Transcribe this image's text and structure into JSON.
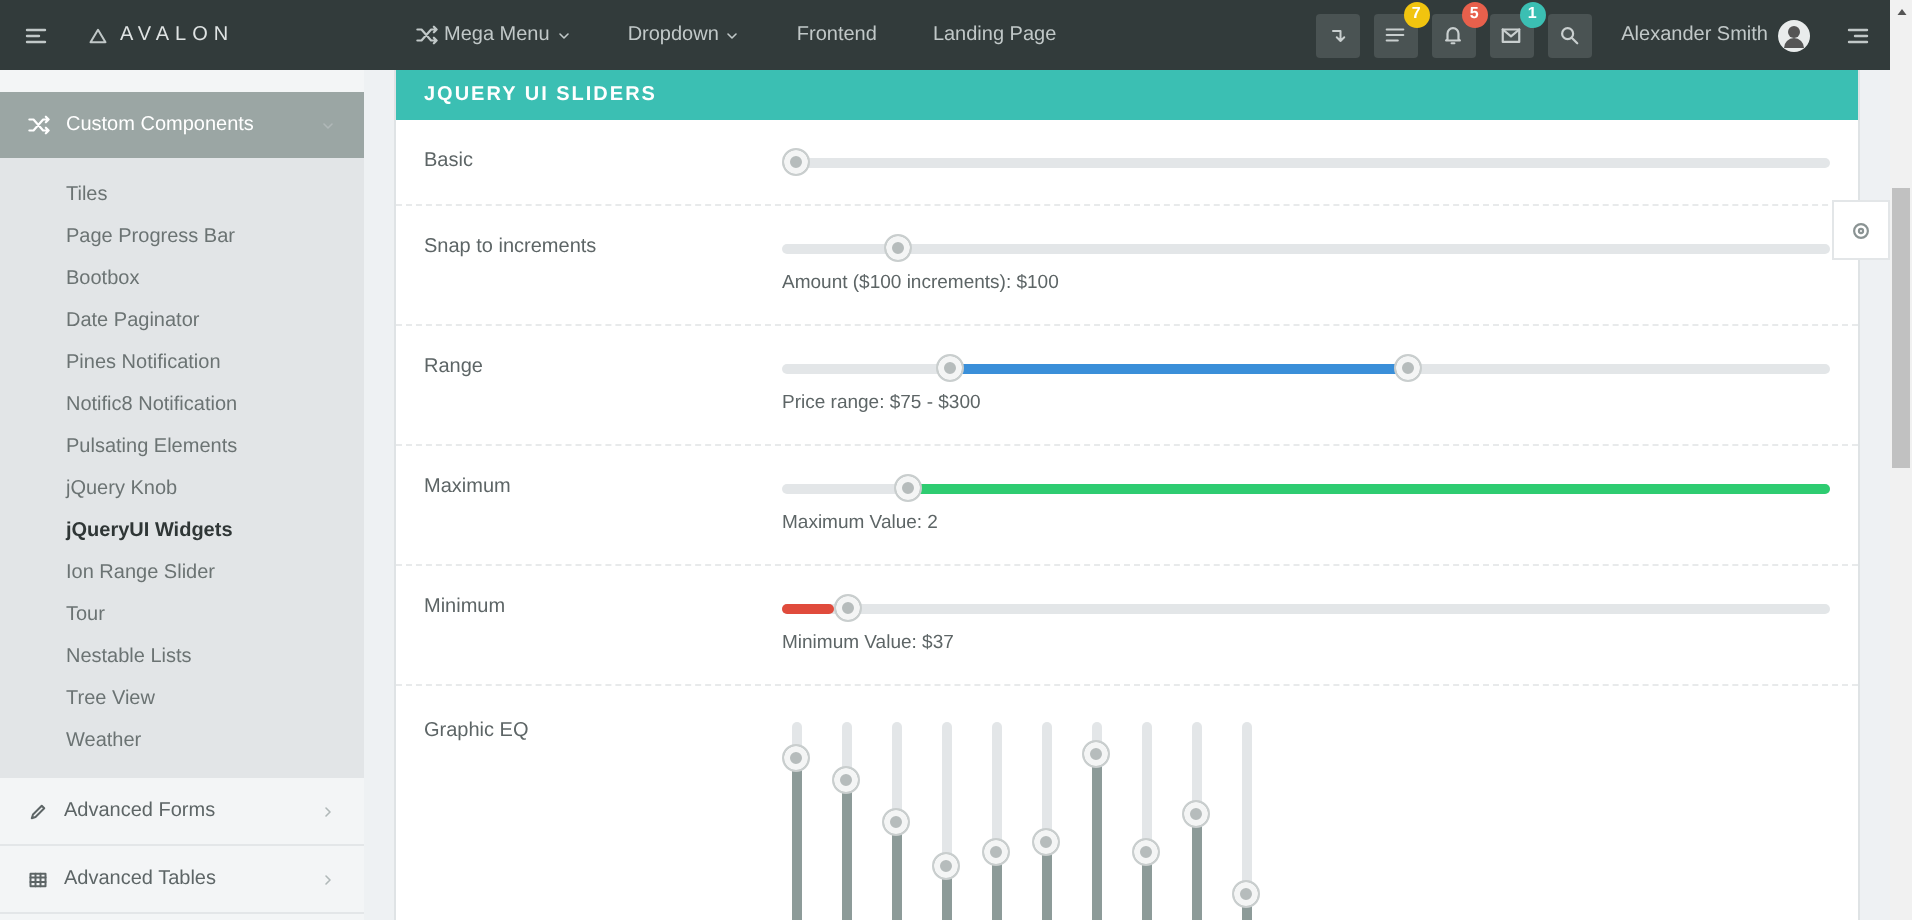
{
  "topbar": {
    "brand": "AVALON",
    "nav": [
      {
        "label": "Mega Menu",
        "icon": true,
        "dropdown": true
      },
      {
        "label": "Dropdown",
        "icon": false,
        "dropdown": true
      },
      {
        "label": "Frontend",
        "icon": false,
        "dropdown": false
      },
      {
        "label": "Landing Page",
        "icon": false,
        "dropdown": false
      }
    ],
    "buttons": [
      {
        "kind": "toggle"
      },
      {
        "kind": "tasks",
        "badge": "7",
        "color": "#f1c40f"
      },
      {
        "kind": "bell",
        "badge": "5",
        "color": "#e8604c"
      },
      {
        "kind": "mail",
        "badge": "1",
        "color": "#3bbfb3"
      },
      {
        "kind": "search"
      }
    ],
    "user": "Alexander Smith"
  },
  "sidebar": {
    "menu": [
      {
        "label": "Custom Components",
        "kind": "shuffle",
        "expanded": true,
        "children": [
          {
            "label": "Tiles",
            "selected": false
          },
          {
            "label": "Page Progress Bar",
            "selected": false
          },
          {
            "label": "Bootbox",
            "selected": false
          },
          {
            "label": "Date Paginator",
            "selected": false
          },
          {
            "label": "Pines Notification",
            "selected": false
          },
          {
            "label": "Notific8 Notification",
            "selected": false
          },
          {
            "label": "Pulsating Elements",
            "selected": false
          },
          {
            "label": "jQuery Knob",
            "selected": false
          },
          {
            "label": "jQueryUI Widgets",
            "selected": true
          },
          {
            "label": "Ion Range Slider",
            "selected": false
          },
          {
            "label": "Tour",
            "selected": false
          },
          {
            "label": "Nestable Lists",
            "selected": false
          },
          {
            "label": "Tree View",
            "selected": false
          },
          {
            "label": "Weather",
            "selected": false
          }
        ]
      },
      {
        "label": "Advanced Forms",
        "kind": "pencil",
        "expanded": false
      },
      {
        "label": "Advanced Tables",
        "kind": "table",
        "expanded": false
      }
    ]
  },
  "panel": {
    "title": "JQUERY UI SLIDERS",
    "rows": [
      {
        "label": "Basic",
        "kind": "single",
        "handles": [
          {
            "level": 0
          }
        ]
      },
      {
        "label": "Snap to increments",
        "kind": "single",
        "handles": [
          {
            "level": 0.1
          }
        ],
        "caption": "Amount ($100 increments): $100"
      },
      {
        "label": "Range",
        "kind": "range",
        "color": "#3a8fd9",
        "handles": [
          {
            "level": 0.15
          },
          {
            "level": 0.6
          }
        ],
        "caption": "Price range: $75 - $300"
      },
      {
        "label": "Maximum",
        "kind": "max",
        "color": "#2ecc71",
        "handles": [
          {
            "level": 0.11
          }
        ],
        "caption": "Maximum Value: 2"
      },
      {
        "label": "Minimum",
        "kind": "min",
        "color": "#e04b3c",
        "handles": [
          {
            "level": 0.05
          }
        ],
        "caption": "Minimum Value: $37"
      },
      {
        "label": "Graphic EQ",
        "kind": "eq",
        "color": "#8d9b99",
        "bands": [
          {
            "level": 0.87
          },
          {
            "level": 0.75
          },
          {
            "level": 0.51
          },
          {
            "level": 0.26
          },
          {
            "level": 0.34
          },
          {
            "level": 0.4
          },
          {
            "level": 0.9
          },
          {
            "level": 0.34
          },
          {
            "level": 0.56
          },
          {
            "level": 0.1
          }
        ]
      }
    ]
  }
}
